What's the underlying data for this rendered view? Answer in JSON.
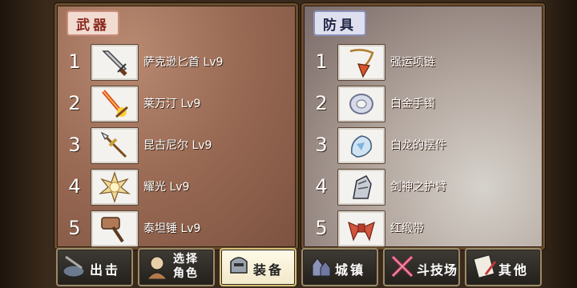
{
  "weapons": {
    "title": "武器",
    "items": [
      {
        "num": "1",
        "name": "萨克逊匕首 Lv9",
        "icon": "dagger-icon"
      },
      {
        "num": "2",
        "name": "莱万汀 Lv9",
        "icon": "flame-sword-icon"
      },
      {
        "num": "3",
        "name": "昆古尼尔 Lv9",
        "icon": "spear-icon"
      },
      {
        "num": "4",
        "name": "耀光 Lv9",
        "icon": "sun-orb-icon"
      },
      {
        "num": "5",
        "name": "泰坦锤 Lv9",
        "icon": "hammer-icon"
      }
    ]
  },
  "armor": {
    "title": "防具",
    "items": [
      {
        "num": "1",
        "name": "强运项链",
        "icon": "necklace-icon"
      },
      {
        "num": "2",
        "name": "白金手镯",
        "icon": "bracelet-icon"
      },
      {
        "num": "3",
        "name": "白龙的摆件",
        "icon": "dragon-ornament-icon"
      },
      {
        "num": "4",
        "name": "剑神之护臂",
        "icon": "gauntlet-icon"
      },
      {
        "num": "5",
        "name": "红缎带",
        "icon": "red-ribbon-icon"
      }
    ]
  },
  "tabs": [
    {
      "label": "出击",
      "icon": "sortie-icon"
    },
    {
      "label": "选择",
      "label2": "角色",
      "icon": "character-icon"
    },
    {
      "label": "装备",
      "icon": "equipment-icon",
      "active": true
    },
    {
      "label": "城镇",
      "icon": "town-icon"
    },
    {
      "label": "斗技场",
      "icon": "arena-icon"
    },
    {
      "label": "其他",
      "icon": "other-icon"
    }
  ]
}
